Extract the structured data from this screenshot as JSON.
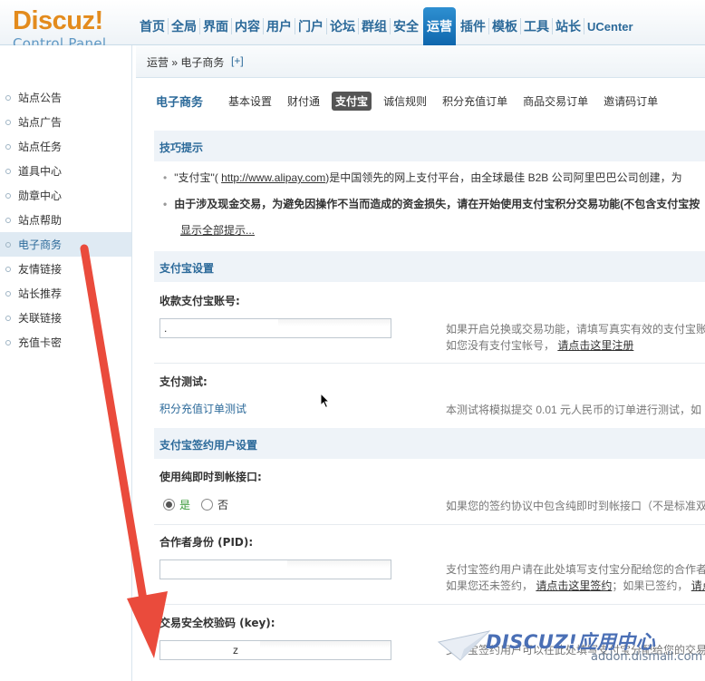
{
  "logo": {
    "word": "Discuz",
    "bang": "!",
    "sub": "Control Panel"
  },
  "nav": {
    "items": [
      "首页",
      "全局",
      "界面",
      "内容",
      "用户",
      "门户",
      "论坛",
      "群组",
      "安全",
      "运营",
      "插件",
      "模板",
      "工具",
      "站长",
      "UCenter"
    ],
    "active": "运营"
  },
  "breadcrumb": {
    "text": "运营 » 电子商务",
    "plus": "[+]"
  },
  "sidebar": {
    "items": [
      "站点公告",
      "站点广告",
      "站点任务",
      "道具中心",
      "勋章中心",
      "站点帮助",
      "电子商务",
      "友情链接",
      "站长推荐",
      "关联链接",
      "充值卡密"
    ],
    "active": "电子商务"
  },
  "subnav": {
    "title": "电子商务",
    "tabs": [
      "基本设置",
      "财付通",
      "支付宝",
      "诚信规则",
      "积分充值订单",
      "商品交易订单",
      "邀请码订单"
    ],
    "active": "支付宝"
  },
  "tips": {
    "header": "技巧提示",
    "line1_pre": "\"支付宝\"(",
    "line1_link": "http://www.alipay.com",
    "line1_post": ")是中国领先的网上支付平台，由全球最佳 B2B 公司阿里巴巴公司创建，为",
    "line2": "由于涉及现金交易，为避免因操作不当而造成的资金损失，请在开始使用支付宝积分交易功能(不包含支付宝按",
    "show_all": "显示全部提示..."
  },
  "alipay_settings": {
    "header": "支付宝设置",
    "account_label": "收款支付宝账号:",
    "account_value": ".",
    "account_hint_1": "如果开启兑换或交易功能，请填写真实有效的支付宝账",
    "account_hint_2_pre": "如您没有支付宝帐号，",
    "account_hint_2_link": "请点击这里注册",
    "test_label": "支付测试:",
    "test_link": "积分充值订单测试",
    "test_hint": "本测试将模拟提交 0.01 元人民币的订单进行测试，如"
  },
  "signed_settings": {
    "header": "支付宝签约用户设置",
    "direct_label": "使用纯即时到帐接口:",
    "yes": "是",
    "no": "否",
    "direct_hint": "如果您的签约协议中包含纯即时到帐接口（不是标准双",
    "pid_label": "合作者身份 (PID):",
    "pid_hint_1": "支付宝签约用户请在此处填写支付宝分配给您的合作者",
    "pid_hint_2_pre": "如果您还未签约，",
    "pid_hint_2_link": "请点击这里签约",
    "pid_hint_2_mid": "；如果已签约，",
    "pid_hint_2_link2": "请点",
    "key_label": "交易安全校验码 (key):",
    "key_value": "z",
    "key_hint": "支付宝签约用户可以在此处填写支付宝分配给您的交易"
  },
  "watermark": {
    "title": "DISCUZ!应用中心",
    "url": "addon.dismall.com"
  },
  "colors": {
    "accent": "#2c6a9a",
    "active_tab": "#1a7ac2",
    "logo": "#e38b1d",
    "arrow": "#ea4b3c"
  }
}
